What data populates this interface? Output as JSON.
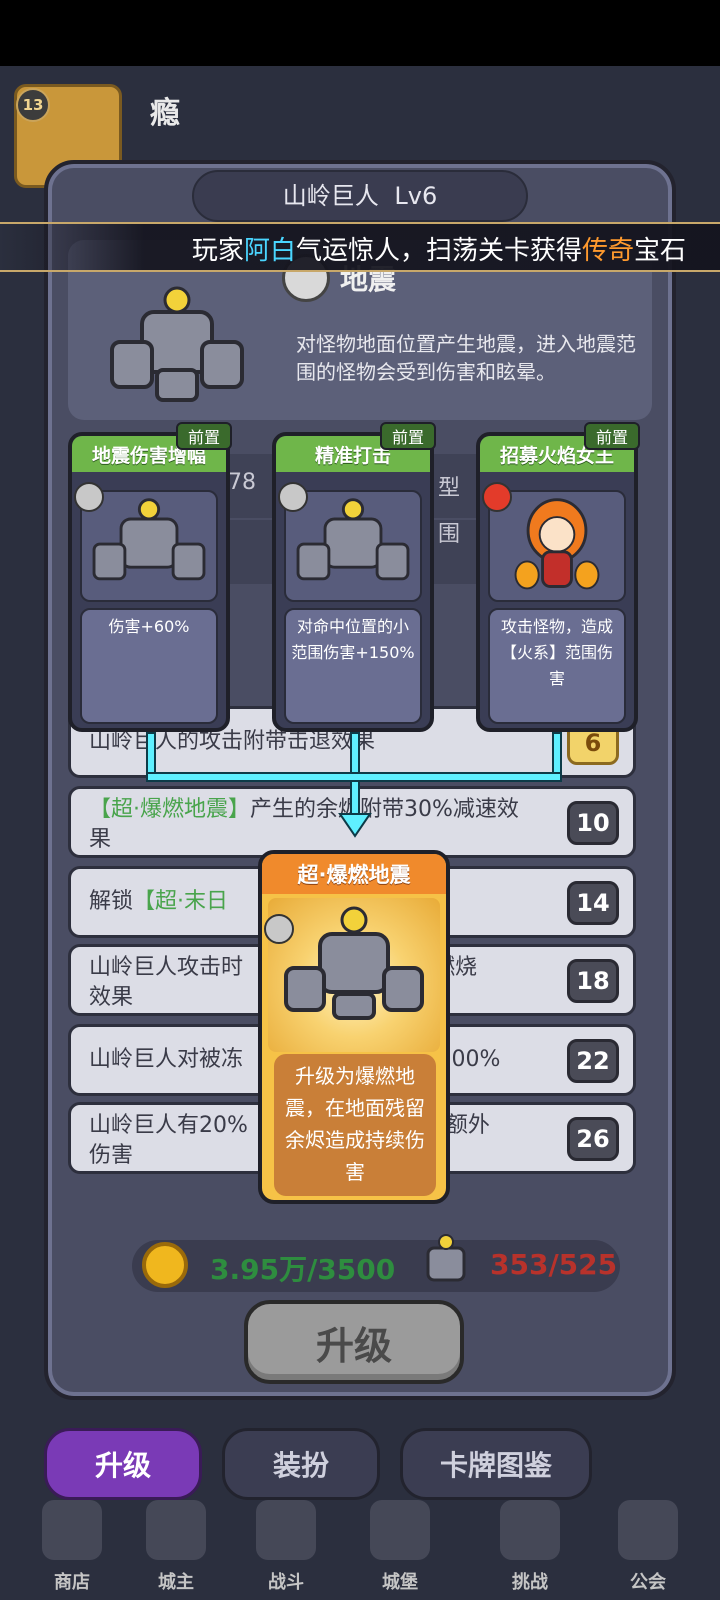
{
  "background": {
    "player_level": "13",
    "player_name_fragment": "瘾"
  },
  "modal": {
    "title": "山岭巨人",
    "level": "Lv6",
    "skill_name": "地震",
    "skill_description": "对怪物地面位置产生地震，进入地震范围的怪物会受到伤害和眩晕。",
    "obscured_fragments": [
      "78",
      "型",
      "围"
    ]
  },
  "broadcast": {
    "prefix": "玩家",
    "player": "阿白",
    "middle": "气运惊人，扫荡关卡获得",
    "item_quality": "传奇",
    "item": "宝石"
  },
  "cards": [
    {
      "title": "地震伤害增幅",
      "prereq_label": "前置",
      "type_icon": "rock-icon",
      "description": "伤害+60%"
    },
    {
      "title": "精准打击",
      "prereq_label": "前置",
      "type_icon": "rock-icon",
      "description": "对命中位置的小范围伤害+150%"
    },
    {
      "title": "招募火焰女王",
      "prereq_label": "前置",
      "type_icon": "fire-icon",
      "description": "攻击怪物，造成【火系】范围伤害"
    }
  ],
  "result_card": {
    "title": "超·爆燃地震",
    "description": "升级为爆燃地震，在地面残留余烬造成持续伤害"
  },
  "upgrade_list": [
    {
      "text": "山岭巨人的攻击附带击退效果",
      "level": "6"
    },
    {
      "text_link": "【超·爆燃地震】",
      "text": "产生的余烬附带30%减速效果",
      "level": "10"
    },
    {
      "text_prefix": "解锁",
      "text_link": "【超·末日",
      "level": "14"
    },
    {
      "text": "山岭巨人攻击时",
      "text_tail": "9燃烧",
      "text2": "效果",
      "level": "18"
    },
    {
      "text": "山岭巨人对被冻",
      "text_tail": "+200%",
      "level": "22"
    },
    {
      "text": "山岭巨人有20%",
      "text_tail": "的额外",
      "text2": "伤害",
      "level": "26"
    }
  ],
  "cost": {
    "coins": "3.95万/3500",
    "shards": "353/525"
  },
  "upgrade_button": "升级",
  "tabs": [
    "升级",
    "装扮",
    "卡牌图鉴"
  ],
  "bottom_nav": [
    "商店",
    "城主",
    "战斗",
    "城堡",
    "挑战",
    "公会"
  ],
  "colors": {
    "card_header_green": "#6fb64a",
    "result_header_orange": "#f08a2c",
    "connector_cyan": "#5ff0ff",
    "highlight_blue": "#4ad6ff",
    "highlight_orange": "#ff9a2e",
    "active_tab_purple": "#7a3ab6"
  }
}
